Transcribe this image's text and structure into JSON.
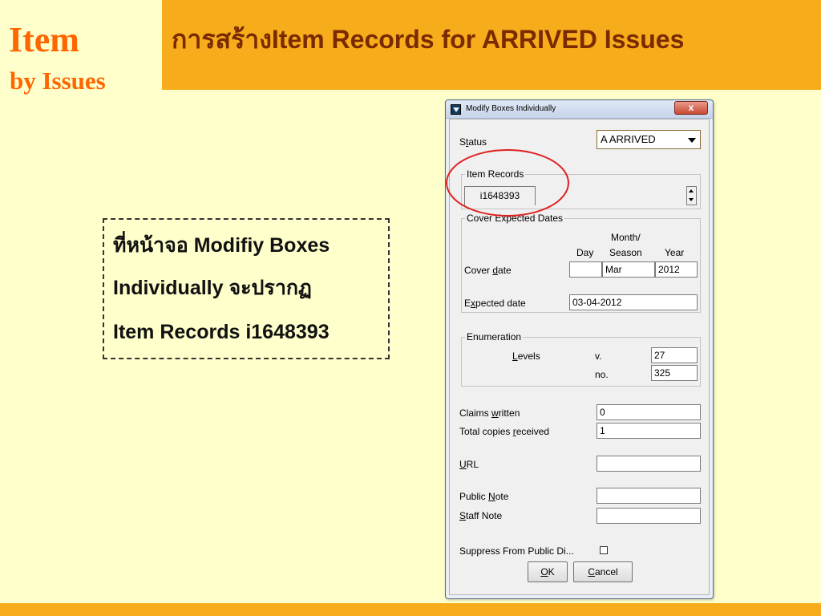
{
  "slide": {
    "title_line1": "Item",
    "title_line2": "by Issues",
    "heading": "การสร้างItem Records for ARRIVED Issues",
    "callout": {
      "line1": "ที่หน้าจอ Modifiy Boxes",
      "line2": "Individually จะปรากฏ",
      "line3": "Item Records i1648393"
    }
  },
  "dialog": {
    "title": "Modify Boxes Individually",
    "close_glyph": "x",
    "status": {
      "label_pre": "S",
      "label_u": "t",
      "label_post": "atus",
      "value": "A ARRIVED"
    },
    "item_records": {
      "title": "Item Records",
      "tab": "i1648393"
    },
    "cover_dates": {
      "title": "Cover  Expected Dates",
      "col_day": "Day",
      "col_month_1": "Month/",
      "col_month_2": "Season",
      "col_year": "Year",
      "cover_label_pre": "Cover ",
      "cover_label_u": "d",
      "cover_label_post": "ate",
      "cover_day": "",
      "cover_month": "Mar",
      "cover_year": "2012",
      "expected_label_pre": "E",
      "expected_label_u": "x",
      "expected_label_post": "pected date",
      "expected_value": "03-04-2012"
    },
    "enumeration": {
      "title": "Enumeration",
      "levels_u": "L",
      "levels_post": "evels",
      "v_label": "v.",
      "v_value": "27",
      "no_label": "no.",
      "no_value": "325"
    },
    "claims": {
      "label_pre": "Claims ",
      "label_u": "w",
      "label_post": "ritten",
      "value": "0"
    },
    "copies": {
      "label_pre": "Total copies ",
      "label_u": "r",
      "label_post": "eceived",
      "value": "1"
    },
    "url": {
      "label_u": "U",
      "label_post": "RL",
      "value": ""
    },
    "public_note": {
      "label_pre": "Public ",
      "label_u": "N",
      "label_post": "ote",
      "value": ""
    },
    "staff_note": {
      "label_u": "S",
      "label_post": "taff Note",
      "value": ""
    },
    "suppress": {
      "label": "Suppress From Public Di..."
    },
    "ok": {
      "label_u": "O",
      "label_post": "K"
    },
    "cancel": {
      "label_u": "C",
      "label_post": "ancel"
    }
  }
}
